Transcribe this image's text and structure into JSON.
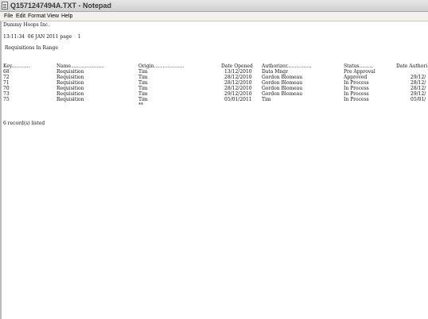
{
  "window": {
    "title": "Q1571247494A.TXT - Notepad"
  },
  "menu": {
    "file": "File",
    "edit": "Edit",
    "format": "Format",
    "view": "View",
    "help": "Help"
  },
  "document": {
    "company": "Dummy Hoops Inc.",
    "timestamp_line": "13:11:34  06 JAN 2011 page    1",
    "report_title": " Requisitions In Range",
    "headers": {
      "key": "Key............",
      "name": "Name......................",
      "origin": "Origin....................",
      "date_opened": "Date Opened",
      "authorizer": "Authorizer................",
      "status": "Status.........",
      "date_authorized": "Date Authori"
    },
    "rows": [
      {
        "key": "68",
        "name": "Requisition",
        "origin": "Tim",
        "date_opened": "13/12/2010",
        "authorizer": "Data Mngr",
        "status": "Pre Approval",
        "date_authorized": ""
      },
      {
        "key": "72",
        "name": "Requisition",
        "origin": "Tim",
        "date_opened": "28/12/2010",
        "authorizer": "Gordon Blomeau",
        "status": "Approved",
        "date_authorized": "29/12/"
      },
      {
        "key": "71",
        "name": "Requisition",
        "origin": "Tim",
        "date_opened": "28/12/2010",
        "authorizer": "Gordon Blomeau",
        "status": "In Process",
        "date_authorized": "28/12/"
      },
      {
        "key": "70",
        "name": "Requisition",
        "origin": "Tim",
        "date_opened": "28/12/2010",
        "authorizer": "Gordon Blomeau",
        "status": "In Process",
        "date_authorized": "28/12/"
      },
      {
        "key": "73",
        "name": "Requisition",
        "origin": "Tim",
        "date_opened": "29/12/2010",
        "authorizer": "Gordon Blomeau",
        "status": "In Process",
        "date_authorized": "29/12/"
      },
      {
        "key": "75",
        "name": "Requisition",
        "origin": "Tim",
        "date_opened": "05/01/2011",
        "authorizer": "Tim",
        "status": "In Process",
        "date_authorized": "05/01/"
      }
    ],
    "origin_footer": "**",
    "records_line": "6 record(s) listed"
  }
}
